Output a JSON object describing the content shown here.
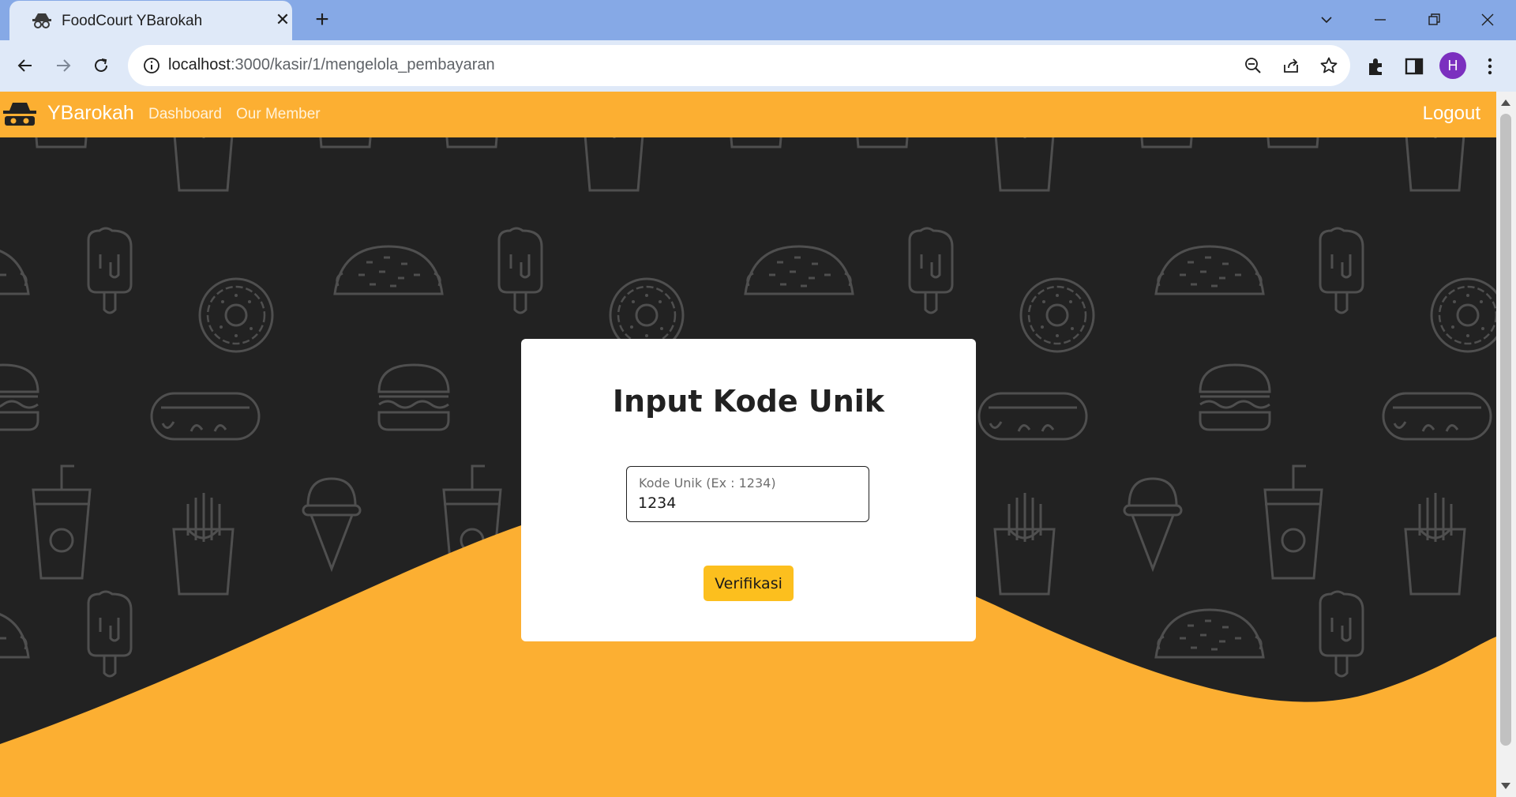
{
  "browser": {
    "tab_title": "FoodCourt YBarokah",
    "url_host": "localhost",
    "url_path": ":3000/kasir/1/mengelola_pembayaran",
    "profile_initial": "H"
  },
  "navbar": {
    "brand": "YBarokah",
    "links": [
      "Dashboard",
      "Our Member"
    ],
    "logout": "Logout"
  },
  "form": {
    "title": "Input Kode Unik",
    "code_label": "Kode Unik (Ex : 1234)",
    "code_value": "1234",
    "submit": "Verifikasi"
  },
  "colors": {
    "accent": "#fcaf32",
    "button": "#fcbf1e",
    "background": "#222222"
  }
}
